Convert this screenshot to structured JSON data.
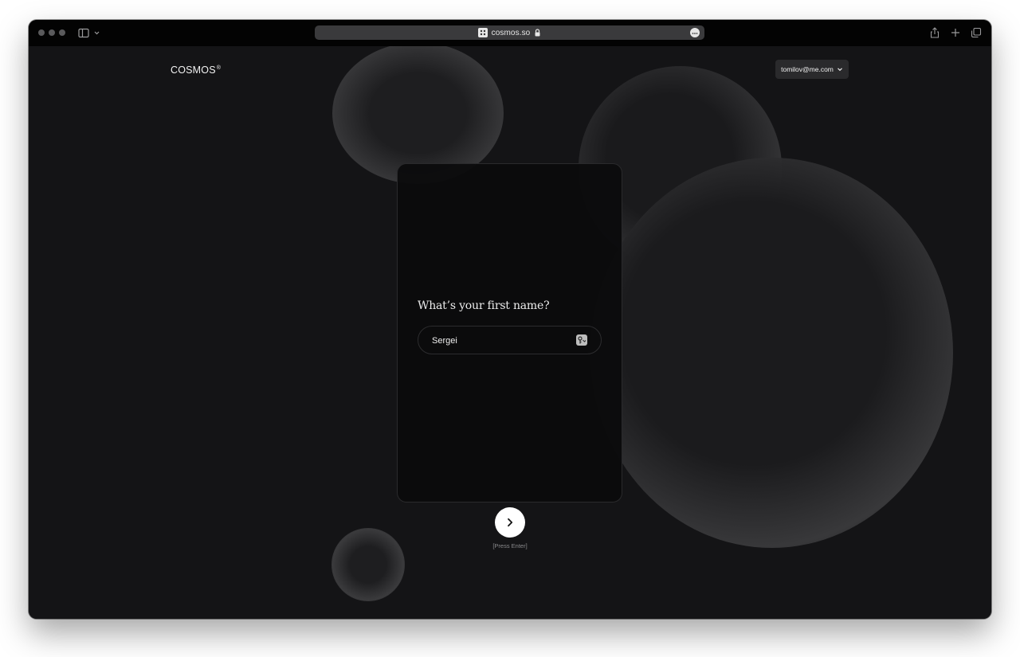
{
  "browser": {
    "url": "cosmos.so",
    "icons": [
      "sidebar-icon",
      "chevron-down-icon",
      "lock-icon",
      "more-icon",
      "share-icon",
      "plus-icon",
      "tabs-icon"
    ]
  },
  "header": {
    "logo": "COSMOS",
    "logo_mark": "®",
    "account_email": "tomilov@me.com"
  },
  "form": {
    "question": "What’s your first name?",
    "name_value": "Sergei",
    "hint": "[Press Enter]"
  },
  "colors": {
    "page_background": "#141416",
    "card_background": "#0b0b0d",
    "button": "#ffffff"
  }
}
